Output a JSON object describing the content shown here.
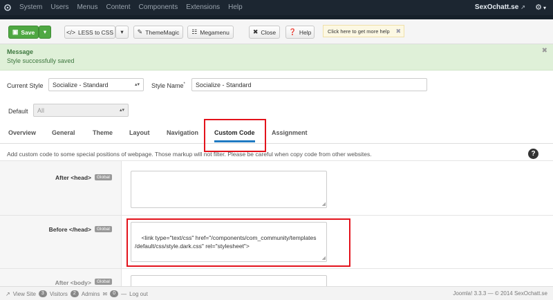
{
  "topbar": {
    "menu": [
      "System",
      "Users",
      "Menus",
      "Content",
      "Components",
      "Extensions",
      "Help"
    ],
    "site_name": "SexOchatt.se"
  },
  "toolbar": {
    "save_label": "Save",
    "less_label": "LESS to CSS",
    "thememagic_label": "ThemeMagic",
    "megamenu_label": "Megamenu",
    "close_label": "Close",
    "help_label": "Help",
    "help_tip": "Click here to get more help"
  },
  "message": {
    "title": "Message",
    "text": "Style successfully saved"
  },
  "form": {
    "current_style_label": "Current Style",
    "current_style_value": "Socialize - Standard",
    "style_name_label": "Style Name",
    "required_mark": "*",
    "style_name_value": "Socialize - Standard",
    "default_label": "Default",
    "default_value": "All"
  },
  "tabs": [
    "Overview",
    "General",
    "Theme",
    "Layout",
    "Navigation",
    "Custom Code",
    "Assignment"
  ],
  "active_tab": "Custom Code",
  "description": "Add custom code to some special positions of webpage. Those markup will not filter. Please be careful when copy code from other websites.",
  "custom_code": {
    "badge": "Global",
    "rows": [
      {
        "label": "After <head>",
        "value": ""
      },
      {
        "label": "Before </head>",
        "value": "<link type=\"text/css\" href=\"/components/com_community/templates\n/default/css/style.dark.css\" rel=\"stylesheet\">"
      },
      {
        "label": "After <body>",
        "value": ""
      }
    ]
  },
  "footer": {
    "view_site": "View Site",
    "visitors_count": "3",
    "visitors_label": "Visitors",
    "admins_count": "2",
    "admins_label": "Admins",
    "messages_count": "0",
    "logout": "Log out",
    "version": "Joomla! 3.3.3",
    "copyright": "— © 2014 SexOchatt.se"
  },
  "colors": {
    "save_green": "#4fa843",
    "active_tab_blue": "#1f7ac2",
    "highlight_red": "#e3121b",
    "success_bg": "#dff0d8"
  }
}
